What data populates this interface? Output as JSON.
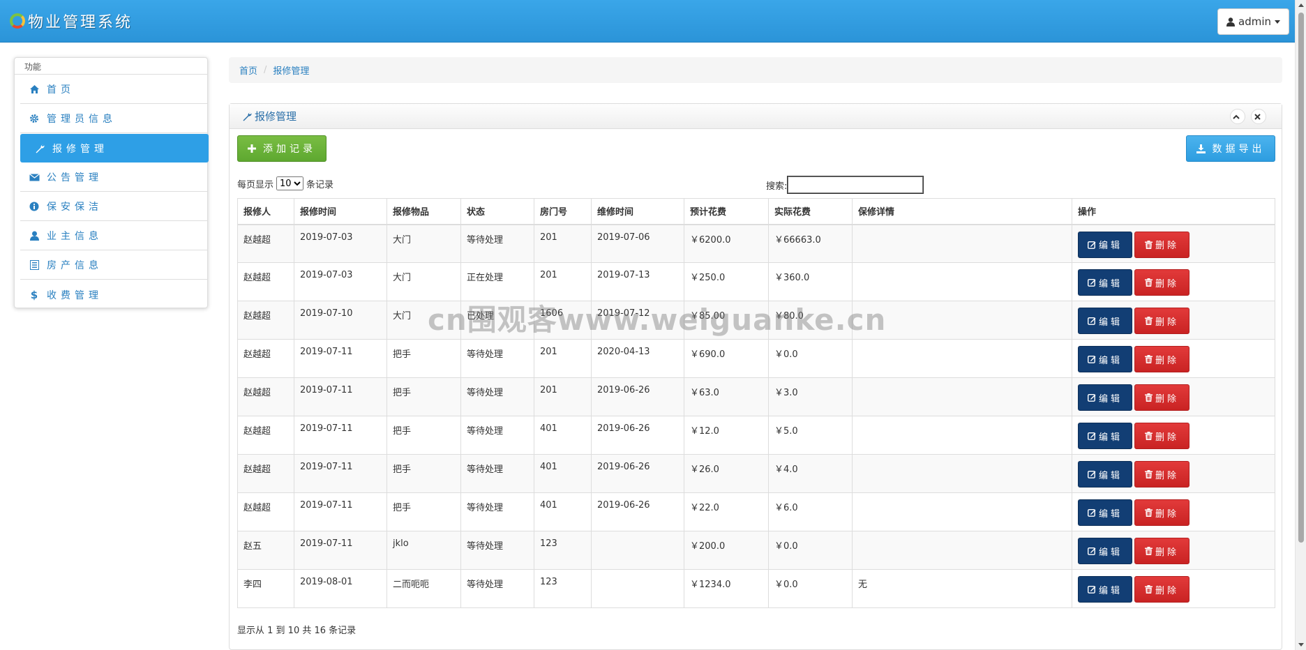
{
  "app": {
    "title": "物业管理系统",
    "user": "admin"
  },
  "sidebar": {
    "section": "功能",
    "items": [
      {
        "label": "首页",
        "icon": "home-icon"
      },
      {
        "label": "管理员信息",
        "icon": "gear-icon"
      },
      {
        "label": "报修管理",
        "icon": "wrench-icon",
        "active": true
      },
      {
        "label": "公告管理",
        "icon": "envelope-icon"
      },
      {
        "label": "保安保洁",
        "icon": "info-icon"
      },
      {
        "label": "业主信息",
        "icon": "user-icon"
      },
      {
        "label": "房产信息",
        "icon": "list-icon"
      },
      {
        "label": "收费管理",
        "icon": "dollar-icon"
      }
    ]
  },
  "breadcrumb": {
    "home": "首页",
    "current": "报修管理"
  },
  "panel": {
    "title": "报修管理",
    "add_label": "添加记录",
    "export_label": "数据导出",
    "page_size_prefix": "每页显示",
    "page_size": "10",
    "page_size_suffix": "条记录",
    "search_label": "搜索:",
    "search_value": ""
  },
  "table": {
    "headers": [
      "报修人",
      "报修时间",
      "报修物品",
      "状态",
      "房门号",
      "维修时间",
      "预计花费",
      "实际花费",
      "保修详情",
      "操作"
    ],
    "edit_label": "编辑",
    "delete_label": "删除",
    "rows": [
      [
        "赵越超",
        "2019-07-03",
        "大门",
        "等待处理",
        "201",
        "2019-07-06",
        "￥6200.0",
        "￥66663.0",
        ""
      ],
      [
        "赵越超",
        "2019-07-03",
        "大门",
        "正在处理",
        "201",
        "2019-07-13",
        "￥250.0",
        "￥360.0",
        ""
      ],
      [
        "赵越超",
        "2019-07-10",
        "大门",
        "已处理",
        "1606",
        "2019-07-12",
        "￥85.00",
        "￥80.0",
        ""
      ],
      [
        "赵越超",
        "2019-07-11",
        "把手",
        "等待处理",
        "201",
        "2020-04-13",
        "￥690.0",
        "￥0.0",
        ""
      ],
      [
        "赵越超",
        "2019-07-11",
        "把手",
        "等待处理",
        "201",
        "2019-06-26",
        "￥63.0",
        "￥3.0",
        ""
      ],
      [
        "赵越超",
        "2019-07-11",
        "把手",
        "等待处理",
        "401",
        "2019-06-26",
        "￥12.0",
        "￥5.0",
        ""
      ],
      [
        "赵越超",
        "2019-07-11",
        "把手",
        "等待处理",
        "401",
        "2019-06-26",
        "￥26.0",
        "￥4.0",
        ""
      ],
      [
        "赵越超",
        "2019-07-11",
        "把手",
        "等待处理",
        "401",
        "2019-06-26",
        "￥22.0",
        "￥6.0",
        ""
      ],
      [
        "赵五",
        "2019-07-11",
        "jklo",
        "等待处理",
        "123",
        "",
        "￥200.0",
        "￥0.0",
        ""
      ],
      [
        "李四",
        "2019-08-01",
        "二而呃呃",
        "等待处理",
        "123",
        "",
        "￥1234.0",
        "￥0.0",
        "无"
      ]
    ]
  },
  "pagination_info": "显示从 1 到 10 共 16 条记录",
  "watermark": "cn围观客www.weiguanke.cn"
}
